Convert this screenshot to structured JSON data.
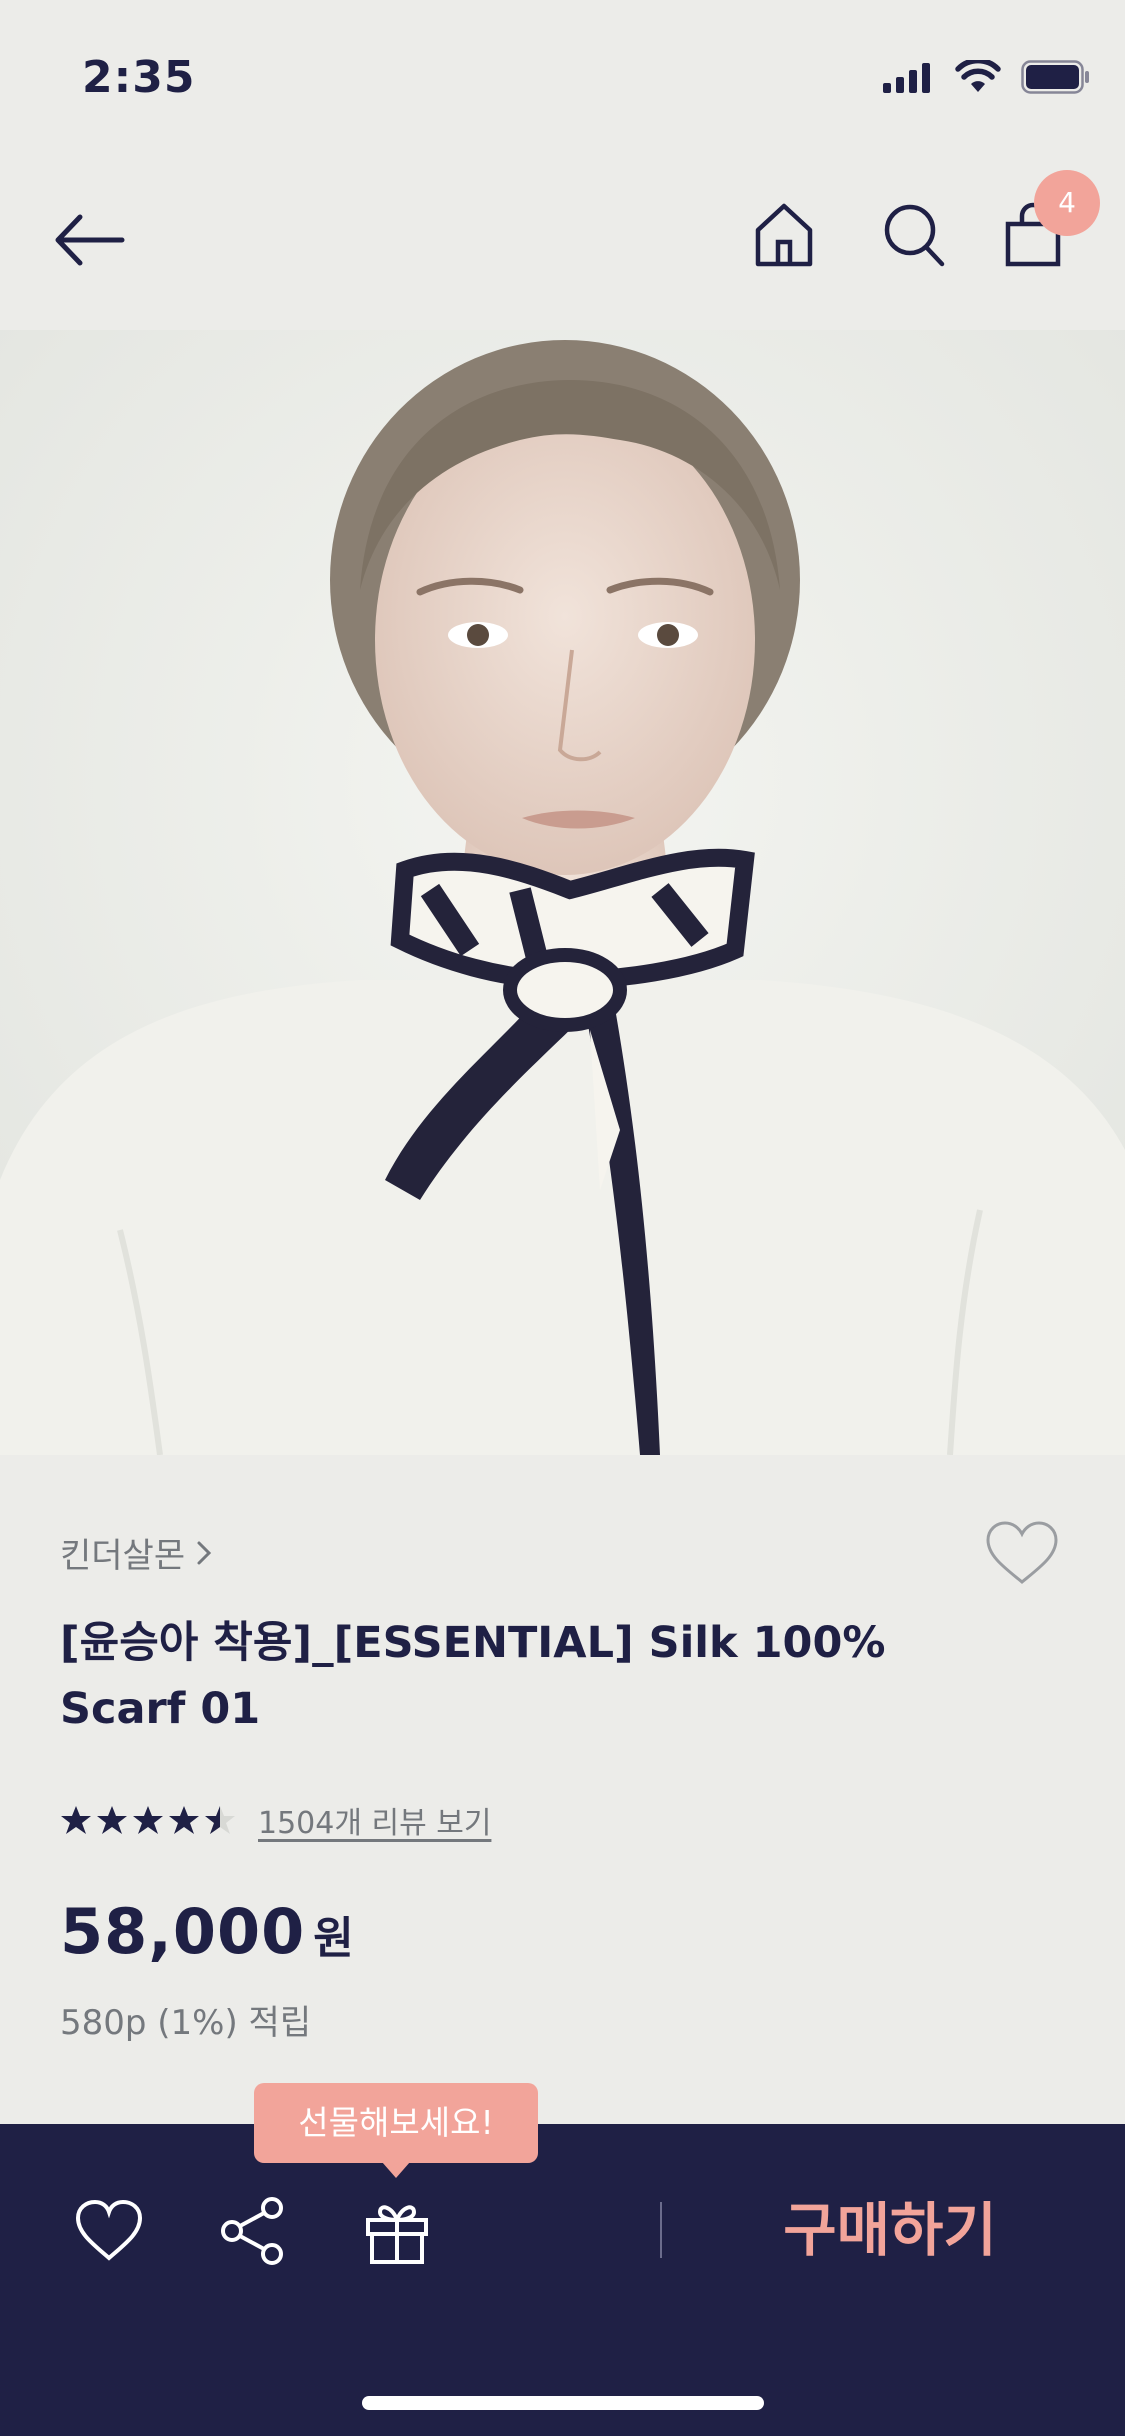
{
  "status_bar": {
    "time": "2:35"
  },
  "nav": {
    "cart_count": "4"
  },
  "product": {
    "brand": "킨더살몬",
    "title": "[윤승아 착용]_[ESSENTIAL] Silk 100% Scarf 01",
    "rating": 4.5,
    "review_link": "1504개 리뷰 보기",
    "price": "58,000",
    "currency": "원",
    "points": "580p (1%) 적립"
  },
  "bottom_bar": {
    "gift_tooltip": "선물해보세요!",
    "buy_label": "구매하기"
  },
  "colors": {
    "navy": "#1f2045",
    "accent": "#f2a49a",
    "background": "#ecece9",
    "muted": "#74787d"
  },
  "icons": [
    "back-arrow-icon",
    "home-icon",
    "search-icon",
    "shopping-bag-icon",
    "heart-icon",
    "share-icon",
    "gift-icon",
    "chevron-right-icon",
    "star-icon"
  ]
}
